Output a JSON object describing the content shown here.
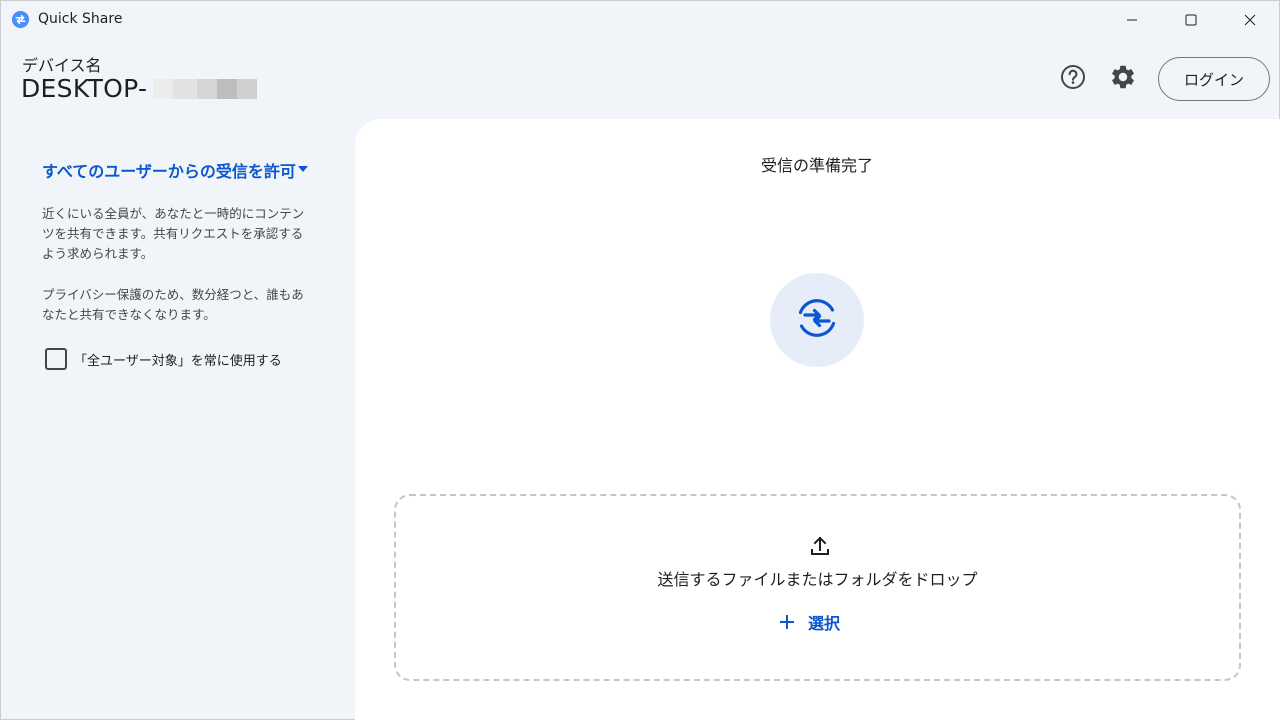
{
  "titlebar": {
    "app_title": "Quick Share",
    "app_icon": "quick-share-icon",
    "minimize_icon": "minimize-icon",
    "maximize_icon": "maximize-icon",
    "close_icon": "close-icon"
  },
  "header": {
    "device_label": "デバイス名",
    "device_name": "DESKTOP-",
    "help_icon": "help-icon",
    "settings_icon": "gear-icon",
    "login_label": "ログイン"
  },
  "sidebar": {
    "receive_mode": "すべてのユーザーからの受信を許可",
    "description_1": "近くにいる全員が、あなたと一時的にコンテンツを共有できます。共有リクエストを承認するよう求められます。",
    "description_2": "プライバシー保護のため、数分経つと、誰もあなたと共有できなくなります。",
    "always_use_label": "「全ユーザー対象」を常に使用する",
    "always_use_checked": false
  },
  "main": {
    "status_title": "受信の準備完了",
    "status_icon": "sync-arrows-icon",
    "drop_text": "送信するファイルまたはフォルダをドロップ",
    "upload_icon": "upload-icon",
    "select_label": "選択",
    "select_icon": "plus-icon"
  },
  "colors": {
    "accent": "#0b57d0",
    "background": "#f1f4f9",
    "panel": "#ffffff",
    "status_circle": "#e6edf8"
  }
}
